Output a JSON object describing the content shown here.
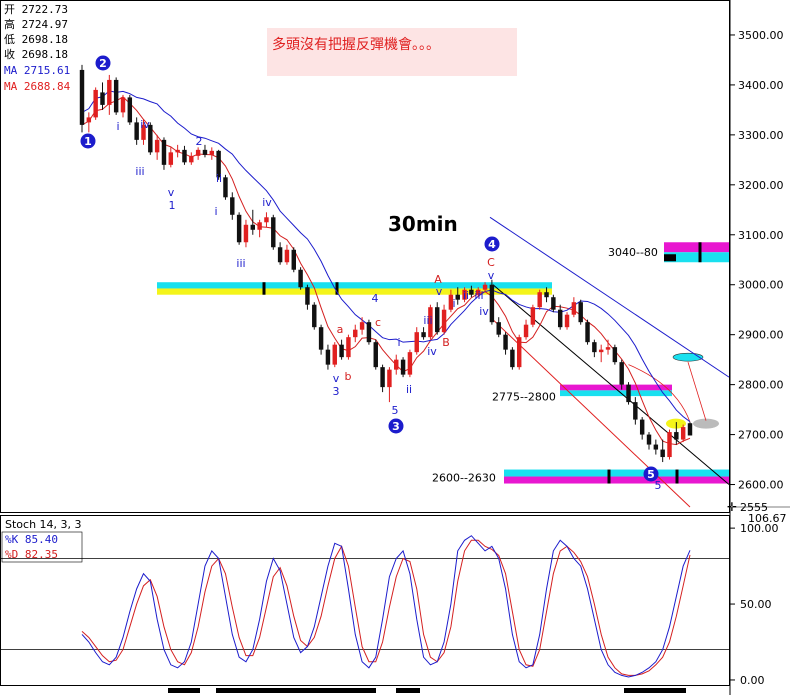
{
  "ohlc_box": {
    "rows": [
      {
        "label": "开",
        "value": "2722.73"
      },
      {
        "label": "高",
        "value": "2724.97"
      },
      {
        "label": "低",
        "value": "2698.18"
      },
      {
        "label": "收",
        "value": "2698.18"
      }
    ],
    "ma_fast": {
      "label": "MA",
      "value": "2715.61",
      "color": "#1c1ccc"
    },
    "ma_slow": {
      "label": "MA",
      "value": "2688.84",
      "color": "#e02020"
    }
  },
  "comment": {
    "text": "多頭沒有把握反彈機會。。。",
    "bg": "#fde4e4",
    "color": "#e02020"
  },
  "title": "30min",
  "colors": {
    "up": "#e02020",
    "down": "#111111",
    "ma_fast": "#1c1ccc",
    "ma_slow": "#d42020",
    "cyan": "#19e0ef",
    "yellow": "#f4f41a",
    "magenta": "#e817d0",
    "blue_wave": "#1c1ccc",
    "red_wave": "#d42020"
  },
  "price_axis": {
    "ticks": [
      "3500.00",
      "3400.00",
      "3300.00",
      "3200.00",
      "3100.00",
      "3000.00",
      "2900.00",
      "2800.00",
      "2700.00",
      "2600.00"
    ],
    "current": "2555",
    "ymin": 2545,
    "ymax": 3570
  },
  "zones": [
    {
      "label": "",
      "low": 2980,
      "high": 3005
    },
    {
      "label": "3040--80",
      "low": 3045,
      "high": 3085
    },
    {
      "label": "2775--2800",
      "low": 2777,
      "high": 2800
    },
    {
      "label": "2600--2630",
      "low": 2602,
      "high": 2630
    }
  ],
  "wave_labels": {
    "major": [
      "1",
      "2",
      "3",
      "4",
      "5"
    ],
    "minor_blue": [
      "i",
      "ii",
      "iii",
      "iv",
      "v",
      "1",
      "2",
      "3",
      "4",
      "5"
    ],
    "minor_red": [
      "a",
      "b",
      "c",
      "A",
      "B",
      "C"
    ]
  },
  "stoch": {
    "title": "Stoch 14, 3, 3",
    "k": {
      "label": "%K",
      "value": "85.40",
      "color": "#1c1ccc"
    },
    "d": {
      "label": "%D",
      "value": "82.35",
      "color": "#d42020"
    },
    "ticks": [
      "100.00",
      "50.00",
      "0.00"
    ],
    "max_label": "106.67",
    "overbought": 80,
    "oversold": 20
  },
  "chart_data": {
    "type": "candlestick",
    "title": "30min",
    "ylim": [
      2545,
      3570
    ],
    "candles": [
      {
        "o": 3430,
        "h": 3440,
        "l": 3305,
        "c": 3320
      },
      {
        "o": 3325,
        "h": 3345,
        "l": 3305,
        "c": 3335
      },
      {
        "o": 3335,
        "h": 3395,
        "l": 3330,
        "c": 3390
      },
      {
        "o": 3385,
        "h": 3405,
        "l": 3350,
        "c": 3360
      },
      {
        "o": 3360,
        "h": 3420,
        "l": 3340,
        "c": 3410
      },
      {
        "o": 3410,
        "h": 3415,
        "l": 3340,
        "c": 3345
      },
      {
        "o": 3345,
        "h": 3380,
        "l": 3335,
        "c": 3375
      },
      {
        "o": 3375,
        "h": 3380,
        "l": 3320,
        "c": 3325
      },
      {
        "o": 3325,
        "h": 3335,
        "l": 3280,
        "c": 3290
      },
      {
        "o": 3290,
        "h": 3330,
        "l": 3280,
        "c": 3320
      },
      {
        "o": 3320,
        "h": 3325,
        "l": 3260,
        "c": 3265
      },
      {
        "o": 3265,
        "h": 3300,
        "l": 3250,
        "c": 3290
      },
      {
        "o": 3290,
        "h": 3295,
        "l": 3230,
        "c": 3240
      },
      {
        "o": 3240,
        "h": 3275,
        "l": 3235,
        "c": 3265
      },
      {
        "o": 3265,
        "h": 3280,
        "l": 3255,
        "c": 3270
      },
      {
        "o": 3270,
        "h": 3278,
        "l": 3240,
        "c": 3245
      },
      {
        "o": 3245,
        "h": 3265,
        "l": 3240,
        "c": 3258
      },
      {
        "o": 3258,
        "h": 3275,
        "l": 3250,
        "c": 3270
      },
      {
        "o": 3270,
        "h": 3280,
        "l": 3255,
        "c": 3260
      },
      {
        "o": 3260,
        "h": 3275,
        "l": 3250,
        "c": 3268
      },
      {
        "o": 3268,
        "h": 3270,
        "l": 3210,
        "c": 3215
      },
      {
        "o": 3215,
        "h": 3220,
        "l": 3170,
        "c": 3175
      },
      {
        "o": 3175,
        "h": 3185,
        "l": 3130,
        "c": 3140
      },
      {
        "o": 3140,
        "h": 3145,
        "l": 3080,
        "c": 3085
      },
      {
        "o": 3085,
        "h": 3130,
        "l": 3075,
        "c": 3120
      },
      {
        "o": 3120,
        "h": 3150,
        "l": 3100,
        "c": 3110
      },
      {
        "o": 3110,
        "h": 3130,
        "l": 3095,
        "c": 3125
      },
      {
        "o": 3125,
        "h": 3145,
        "l": 3115,
        "c": 3135
      },
      {
        "o": 3135,
        "h": 3140,
        "l": 3070,
        "c": 3075
      },
      {
        "o": 3075,
        "h": 3085,
        "l": 3040,
        "c": 3045
      },
      {
        "o": 3045,
        "h": 3080,
        "l": 3040,
        "c": 3070
      },
      {
        "o": 3070,
        "h": 3075,
        "l": 3025,
        "c": 3030
      },
      {
        "o": 3030,
        "h": 3035,
        "l": 2990,
        "c": 2995
      },
      {
        "o": 2995,
        "h": 3000,
        "l": 2950,
        "c": 2960
      },
      {
        "o": 2960,
        "h": 2965,
        "l": 2910,
        "c": 2915
      },
      {
        "o": 2915,
        "h": 2920,
        "l": 2860,
        "c": 2870
      },
      {
        "o": 2870,
        "h": 2880,
        "l": 2830,
        "c": 2840
      },
      {
        "o": 2840,
        "h": 2885,
        "l": 2835,
        "c": 2880
      },
      {
        "o": 2880,
        "h": 2890,
        "l": 2850,
        "c": 2855
      },
      {
        "o": 2855,
        "h": 2900,
        "l": 2850,
        "c": 2895
      },
      {
        "o": 2895,
        "h": 2920,
        "l": 2885,
        "c": 2910
      },
      {
        "o": 2910,
        "h": 2935,
        "l": 2900,
        "c": 2925
      },
      {
        "o": 2925,
        "h": 2930,
        "l": 2880,
        "c": 2885
      },
      {
        "o": 2885,
        "h": 2890,
        "l": 2830,
        "c": 2835
      },
      {
        "o": 2835,
        "h": 2840,
        "l": 2785,
        "c": 2795
      },
      {
        "o": 2795,
        "h": 2835,
        "l": 2765,
        "c": 2830
      },
      {
        "o": 2830,
        "h": 2860,
        "l": 2820,
        "c": 2850
      },
      {
        "o": 2850,
        "h": 2855,
        "l": 2815,
        "c": 2820
      },
      {
        "o": 2820,
        "h": 2870,
        "l": 2815,
        "c": 2865
      },
      {
        "o": 2865,
        "h": 2915,
        "l": 2860,
        "c": 2905
      },
      {
        "o": 2905,
        "h": 2915,
        "l": 2890,
        "c": 2895
      },
      {
        "o": 2895,
        "h": 2960,
        "l": 2890,
        "c": 2955
      },
      {
        "o": 2955,
        "h": 2965,
        "l": 2900,
        "c": 2905
      },
      {
        "o": 2905,
        "h": 2960,
        "l": 2900,
        "c": 2950
      },
      {
        "o": 2950,
        "h": 2990,
        "l": 2945,
        "c": 2980
      },
      {
        "o": 2980,
        "h": 2995,
        "l": 2960,
        "c": 2970
      },
      {
        "o": 2970,
        "h": 2995,
        "l": 2965,
        "c": 2990
      },
      {
        "o": 2990,
        "h": 2998,
        "l": 2975,
        "c": 2980
      },
      {
        "o": 2980,
        "h": 2995,
        "l": 2975,
        "c": 2990
      },
      {
        "o": 2990,
        "h": 3005,
        "l": 2985,
        "c": 3000
      },
      {
        "o": 3000,
        "h": 3010,
        "l": 2920,
        "c": 2925
      },
      {
        "o": 2925,
        "h": 2935,
        "l": 2895,
        "c": 2900
      },
      {
        "o": 2900,
        "h": 2905,
        "l": 2860,
        "c": 2870
      },
      {
        "o": 2870,
        "h": 2875,
        "l": 2830,
        "c": 2835
      },
      {
        "o": 2835,
        "h": 2900,
        "l": 2830,
        "c": 2895
      },
      {
        "o": 2895,
        "h": 2930,
        "l": 2890,
        "c": 2920
      },
      {
        "o": 2920,
        "h": 2960,
        "l": 2915,
        "c": 2955
      },
      {
        "o": 2955,
        "h": 2990,
        "l": 2950,
        "c": 2985
      },
      {
        "o": 2985,
        "h": 2995,
        "l": 2965,
        "c": 2975
      },
      {
        "o": 2975,
        "h": 2980,
        "l": 2945,
        "c": 2950
      },
      {
        "o": 2950,
        "h": 2960,
        "l": 2910,
        "c": 2915
      },
      {
        "o": 2915,
        "h": 2945,
        "l": 2910,
        "c": 2940
      },
      {
        "o": 2940,
        "h": 2975,
        "l": 2935,
        "c": 2965
      },
      {
        "o": 2965,
        "h": 2970,
        "l": 2920,
        "c": 2925
      },
      {
        "o": 2925,
        "h": 2930,
        "l": 2880,
        "c": 2885
      },
      {
        "o": 2885,
        "h": 2890,
        "l": 2855,
        "c": 2865
      },
      {
        "o": 2865,
        "h": 2880,
        "l": 2845,
        "c": 2870
      },
      {
        "o": 2870,
        "h": 2890,
        "l": 2860,
        "c": 2875
      },
      {
        "o": 2875,
        "h": 2880,
        "l": 2840,
        "c": 2845
      },
      {
        "o": 2845,
        "h": 2850,
        "l": 2790,
        "c": 2800
      },
      {
        "o": 2800,
        "h": 2805,
        "l": 2760,
        "c": 2765
      },
      {
        "o": 2765,
        "h": 2775,
        "l": 2720,
        "c": 2730
      },
      {
        "o": 2730,
        "h": 2735,
        "l": 2690,
        "c": 2700
      },
      {
        "o": 2700,
        "h": 2705,
        "l": 2670,
        "c": 2680
      },
      {
        "o": 2680,
        "h": 2690,
        "l": 2660,
        "c": 2670
      },
      {
        "o": 2670,
        "h": 2690,
        "l": 2645,
        "c": 2655
      },
      {
        "o": 2655,
        "h": 2710,
        "l": 2650,
        "c": 2705
      },
      {
        "o": 2705,
        "h": 2725,
        "l": 2680,
        "c": 2690
      },
      {
        "o": 2690,
        "h": 2720,
        "l": 2685,
        "c": 2715
      },
      {
        "o": 2722.73,
        "h": 2724.97,
        "l": 2698.18,
        "c": 2698.18
      }
    ],
    "stoch_k": [
      30,
      25,
      18,
      12,
      10,
      15,
      28,
      45,
      60,
      70,
      65,
      40,
      20,
      10,
      8,
      12,
      25,
      50,
      75,
      85,
      80,
      55,
      30,
      15,
      12,
      20,
      40,
      65,
      80,
      72,
      50,
      28,
      18,
      22,
      35,
      55,
      75,
      90,
      88,
      60,
      30,
      12,
      8,
      15,
      40,
      68,
      80,
      85,
      70,
      40,
      15,
      10,
      12,
      25,
      50,
      85,
      92,
      95,
      90,
      85,
      88,
      80,
      60,
      30,
      12,
      8,
      10,
      30,
      60,
      85,
      92,
      88,
      80,
      75,
      60,
      40,
      20,
      10,
      5,
      3,
      2,
      3,
      5,
      8,
      12,
      20,
      35,
      55,
      75,
      85.4
    ],
    "stoch_d": [
      32,
      28,
      22,
      16,
      12,
      13,
      20,
      35,
      50,
      62,
      66,
      55,
      35,
      20,
      12,
      10,
      18,
      35,
      58,
      75,
      80,
      70,
      48,
      28,
      16,
      16,
      28,
      48,
      68,
      74,
      62,
      42,
      26,
      22,
      28,
      42,
      62,
      80,
      88,
      75,
      48,
      22,
      12,
      12,
      25,
      48,
      68,
      80,
      78,
      60,
      30,
      15,
      12,
      18,
      35,
      65,
      85,
      92,
      92,
      88,
      86,
      82,
      70,
      45,
      20,
      10,
      9,
      20,
      45,
      70,
      85,
      88,
      84,
      78,
      68,
      50,
      30,
      15,
      8,
      4,
      3,
      3,
      4,
      6,
      10,
      15,
      25,
      42,
      62,
      82.35
    ]
  }
}
